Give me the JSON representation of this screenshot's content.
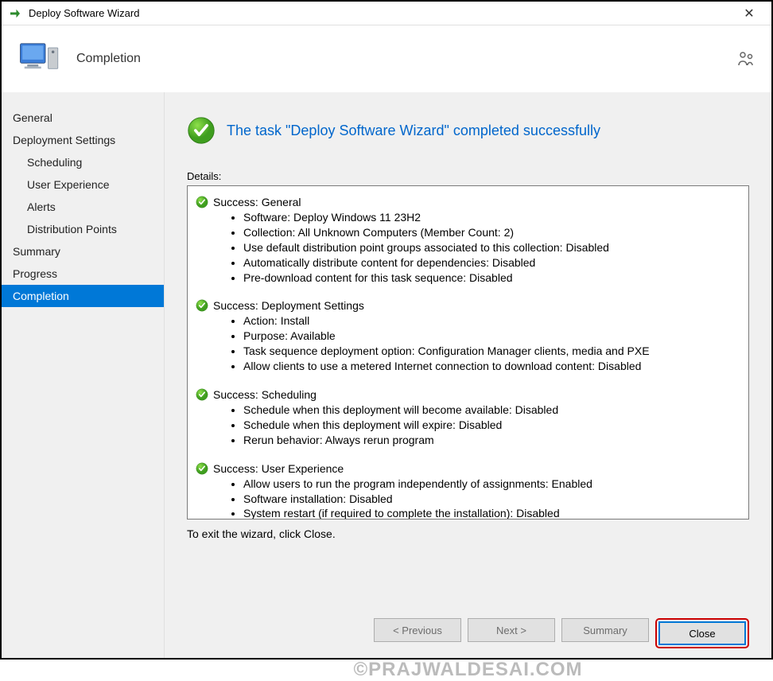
{
  "window": {
    "title": "Deploy Software Wizard"
  },
  "header": {
    "page_title": "Completion"
  },
  "sidebar": {
    "items": [
      {
        "label": "General",
        "indent": false,
        "selected": false
      },
      {
        "label": "Deployment Settings",
        "indent": false,
        "selected": false
      },
      {
        "label": "Scheduling",
        "indent": true,
        "selected": false
      },
      {
        "label": "User Experience",
        "indent": true,
        "selected": false
      },
      {
        "label": "Alerts",
        "indent": true,
        "selected": false
      },
      {
        "label": "Distribution Points",
        "indent": true,
        "selected": false
      },
      {
        "label": "Summary",
        "indent": false,
        "selected": false
      },
      {
        "label": "Progress",
        "indent": false,
        "selected": false
      },
      {
        "label": "Completion",
        "indent": false,
        "selected": true
      }
    ]
  },
  "completion": {
    "success_message": "The task \"Deploy Software Wizard\" completed successfully",
    "details_label": "Details:",
    "sections": [
      {
        "title": "Success: General",
        "items": [
          "Software: Deploy Windows 11 23H2",
          "Collection: All Unknown Computers (Member Count: 2)",
          "Use default distribution point groups associated to this collection: Disabled",
          "Automatically distribute content for dependencies: Disabled",
          "Pre-download content for this task sequence: Disabled"
        ]
      },
      {
        "title": "Success: Deployment Settings",
        "items": [
          "Action: Install",
          "Purpose: Available",
          "Task sequence deployment option: Configuration Manager clients, media and PXE",
          "Allow clients to use a metered Internet connection to download content: Disabled"
        ]
      },
      {
        "title": "Success: Scheduling",
        "items": [
          "Schedule when this deployment will become available: Disabled",
          "Schedule when this deployment will expire: Disabled",
          "Rerun behavior: Always rerun program"
        ]
      },
      {
        "title": "Success: User Experience",
        "items": [
          "Allow users to run the program independently of assignments: Enabled",
          "Software installation: Disabled",
          "System restart (if required to complete the installation): Disabled"
        ]
      }
    ],
    "exit_hint": "To exit the wizard, click Close."
  },
  "buttons": {
    "previous": "< Previous",
    "next": "Next >",
    "summary": "Summary",
    "close": "Close"
  },
  "watermark": "©PRAJWALDESAI.COM"
}
